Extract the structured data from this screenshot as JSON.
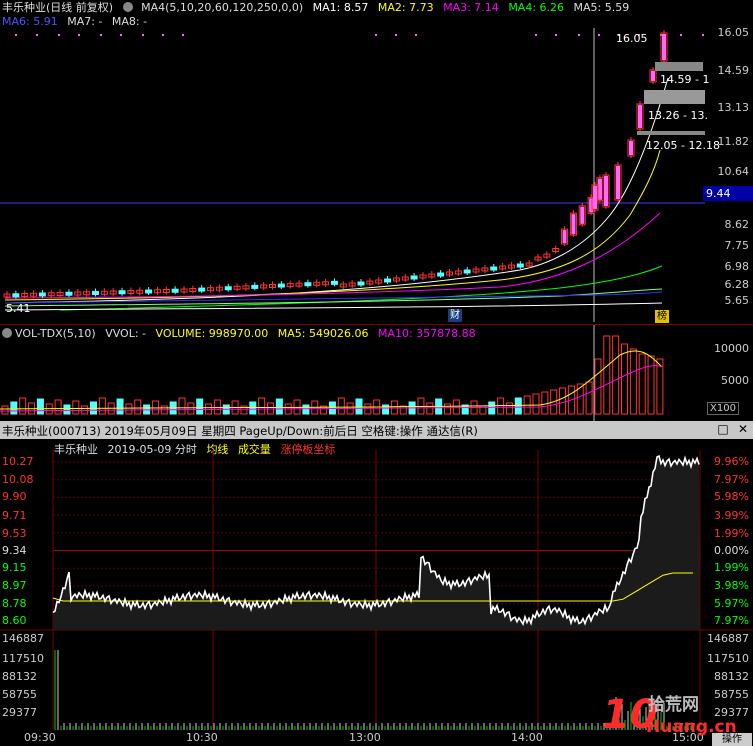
{
  "kline": {
    "legend_row1": {
      "title": "丰乐种业(日线 前复权)",
      "ma4": "MA4(5,10,20,60,120,250,0,0)",
      "ma1": "MA1: 8.57",
      "ma2": "MA2: 7.73",
      "ma3": "MA3: 7.14",
      "ma4v": "MA4: 6.26",
      "ma5": "MA5: 5.59"
    },
    "legend_row2": {
      "ma6": "MA6: 5.91",
      "ma7": "MA7: -",
      "ma8": "MA8: -"
    },
    "y_axis": [
      "16.05",
      "14.59",
      "13.13",
      "11.82",
      "10.64",
      "9.44",
      "8.62",
      "7.75",
      "6.98",
      "6.28",
      "5.65"
    ],
    "annotations": {
      "high": "16.05",
      "low": "5.41",
      "zone1": "14.59 - 1",
      "zone2": "13.26 - 13.",
      "zone3": "12.05 - 12.18"
    },
    "current_price": "9.44",
    "badge_cai": "财",
    "badge_bang": "榜"
  },
  "volume": {
    "legend": {
      "name": "VOL-TDX(5,10)",
      "vvol": "VVOL: -",
      "volume": "VOLUME: 998970.00",
      "ma5": "MA5: 549026.06",
      "ma10": "MA10: 357878.88"
    },
    "y_axis": [
      "10000",
      "5000"
    ],
    "unit": "X100"
  },
  "intraday_window": {
    "title": "丰乐种业(000713) 2019年05月09日 星期四 PageUp/Down:前后日 空格键:操作 通达信(R)",
    "max_icon": "□",
    "close_icon": "✕",
    "header": {
      "name": "丰乐种业",
      "date": "2019-05-09 分时",
      "avg": "均线",
      "volume": "成交量",
      "limit": "涨停板坐标"
    },
    "price_axis_left": [
      "10.27",
      "10.08",
      "9.90",
      "9.71",
      "9.53",
      "9.34",
      "9.15",
      "8.97",
      "8.78",
      "8.60"
    ],
    "pct_axis_right": [
      "9.96%",
      "7.97%",
      "5.98%",
      "3.99%",
      "1.99%",
      "0.00%",
      "1.99%",
      "3.98%",
      "5.97%",
      "7.97%"
    ],
    "vol_axis_left": [
      "146887",
      "117510",
      "88132",
      "58755",
      "29377"
    ],
    "vol_axis_right": [
      "146887",
      "117510",
      "88132",
      "58755",
      "29377"
    ],
    "times": [
      "09:30",
      "10:30",
      "13:00",
      "14:00",
      "15:00"
    ],
    "action_label": "操作"
  },
  "colors": {
    "up": "#ff3232",
    "down": "#54ffff",
    "ma1": "#ffffff",
    "ma2": "#ffff00",
    "ma3": "#ff00ff",
    "ma4": "#00ff00",
    "ma5": "#ffffff",
    "ma6": "#3030ff",
    "grid": "#7a0000",
    "price_line": "#ffffff",
    "avg_line": "#ffff00"
  }
}
